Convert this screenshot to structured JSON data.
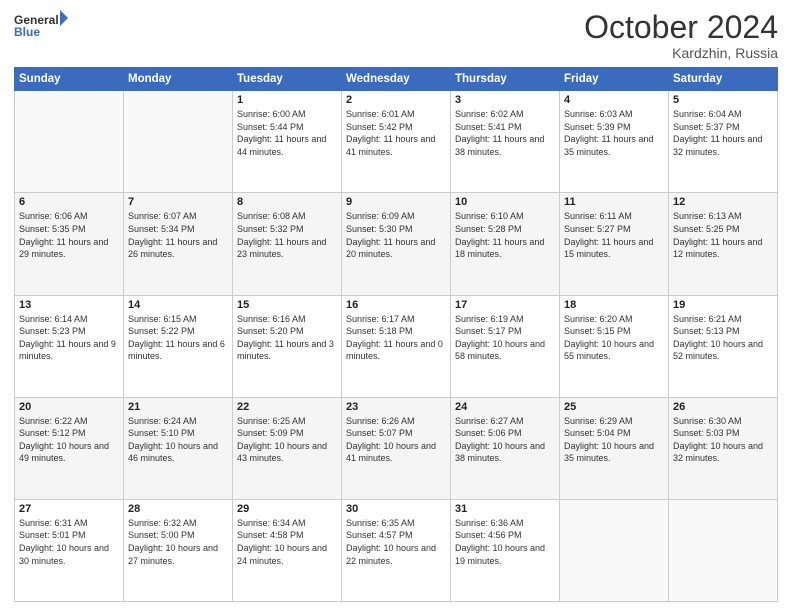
{
  "header": {
    "logo_line1": "General",
    "logo_line2": "Blue",
    "month": "October 2024",
    "location": "Kardzhin, Russia"
  },
  "weekdays": [
    "Sunday",
    "Monday",
    "Tuesday",
    "Wednesday",
    "Thursday",
    "Friday",
    "Saturday"
  ],
  "weeks": [
    [
      {
        "day": "",
        "info": ""
      },
      {
        "day": "",
        "info": ""
      },
      {
        "day": "1",
        "info": "Sunrise: 6:00 AM\nSunset: 5:44 PM\nDaylight: 11 hours and 44 minutes."
      },
      {
        "day": "2",
        "info": "Sunrise: 6:01 AM\nSunset: 5:42 PM\nDaylight: 11 hours and 41 minutes."
      },
      {
        "day": "3",
        "info": "Sunrise: 6:02 AM\nSunset: 5:41 PM\nDaylight: 11 hours and 38 minutes."
      },
      {
        "day": "4",
        "info": "Sunrise: 6:03 AM\nSunset: 5:39 PM\nDaylight: 11 hours and 35 minutes."
      },
      {
        "day": "5",
        "info": "Sunrise: 6:04 AM\nSunset: 5:37 PM\nDaylight: 11 hours and 32 minutes."
      }
    ],
    [
      {
        "day": "6",
        "info": "Sunrise: 6:06 AM\nSunset: 5:35 PM\nDaylight: 11 hours and 29 minutes."
      },
      {
        "day": "7",
        "info": "Sunrise: 6:07 AM\nSunset: 5:34 PM\nDaylight: 11 hours and 26 minutes."
      },
      {
        "day": "8",
        "info": "Sunrise: 6:08 AM\nSunset: 5:32 PM\nDaylight: 11 hours and 23 minutes."
      },
      {
        "day": "9",
        "info": "Sunrise: 6:09 AM\nSunset: 5:30 PM\nDaylight: 11 hours and 20 minutes."
      },
      {
        "day": "10",
        "info": "Sunrise: 6:10 AM\nSunset: 5:28 PM\nDaylight: 11 hours and 18 minutes."
      },
      {
        "day": "11",
        "info": "Sunrise: 6:11 AM\nSunset: 5:27 PM\nDaylight: 11 hours and 15 minutes."
      },
      {
        "day": "12",
        "info": "Sunrise: 6:13 AM\nSunset: 5:25 PM\nDaylight: 11 hours and 12 minutes."
      }
    ],
    [
      {
        "day": "13",
        "info": "Sunrise: 6:14 AM\nSunset: 5:23 PM\nDaylight: 11 hours and 9 minutes."
      },
      {
        "day": "14",
        "info": "Sunrise: 6:15 AM\nSunset: 5:22 PM\nDaylight: 11 hours and 6 minutes."
      },
      {
        "day": "15",
        "info": "Sunrise: 6:16 AM\nSunset: 5:20 PM\nDaylight: 11 hours and 3 minutes."
      },
      {
        "day": "16",
        "info": "Sunrise: 6:17 AM\nSunset: 5:18 PM\nDaylight: 11 hours and 0 minutes."
      },
      {
        "day": "17",
        "info": "Sunrise: 6:19 AM\nSunset: 5:17 PM\nDaylight: 10 hours and 58 minutes."
      },
      {
        "day": "18",
        "info": "Sunrise: 6:20 AM\nSunset: 5:15 PM\nDaylight: 10 hours and 55 minutes."
      },
      {
        "day": "19",
        "info": "Sunrise: 6:21 AM\nSunset: 5:13 PM\nDaylight: 10 hours and 52 minutes."
      }
    ],
    [
      {
        "day": "20",
        "info": "Sunrise: 6:22 AM\nSunset: 5:12 PM\nDaylight: 10 hours and 49 minutes."
      },
      {
        "day": "21",
        "info": "Sunrise: 6:24 AM\nSunset: 5:10 PM\nDaylight: 10 hours and 46 minutes."
      },
      {
        "day": "22",
        "info": "Sunrise: 6:25 AM\nSunset: 5:09 PM\nDaylight: 10 hours and 43 minutes."
      },
      {
        "day": "23",
        "info": "Sunrise: 6:26 AM\nSunset: 5:07 PM\nDaylight: 10 hours and 41 minutes."
      },
      {
        "day": "24",
        "info": "Sunrise: 6:27 AM\nSunset: 5:06 PM\nDaylight: 10 hours and 38 minutes."
      },
      {
        "day": "25",
        "info": "Sunrise: 6:29 AM\nSunset: 5:04 PM\nDaylight: 10 hours and 35 minutes."
      },
      {
        "day": "26",
        "info": "Sunrise: 6:30 AM\nSunset: 5:03 PM\nDaylight: 10 hours and 32 minutes."
      }
    ],
    [
      {
        "day": "27",
        "info": "Sunrise: 6:31 AM\nSunset: 5:01 PM\nDaylight: 10 hours and 30 minutes."
      },
      {
        "day": "28",
        "info": "Sunrise: 6:32 AM\nSunset: 5:00 PM\nDaylight: 10 hours and 27 minutes."
      },
      {
        "day": "29",
        "info": "Sunrise: 6:34 AM\nSunset: 4:58 PM\nDaylight: 10 hours and 24 minutes."
      },
      {
        "day": "30",
        "info": "Sunrise: 6:35 AM\nSunset: 4:57 PM\nDaylight: 10 hours and 22 minutes."
      },
      {
        "day": "31",
        "info": "Sunrise: 6:36 AM\nSunset: 4:56 PM\nDaylight: 10 hours and 19 minutes."
      },
      {
        "day": "",
        "info": ""
      },
      {
        "day": "",
        "info": ""
      }
    ]
  ]
}
